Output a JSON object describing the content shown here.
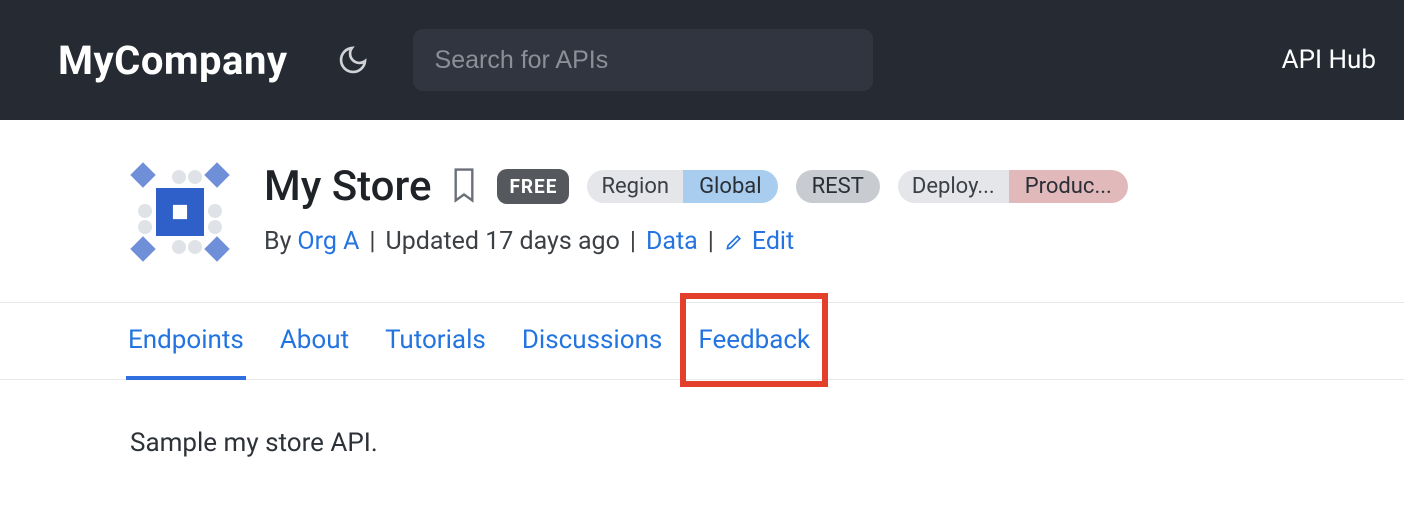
{
  "header": {
    "brand": "MyCompany",
    "search_placeholder": "Search for APIs",
    "hub_link": "API Hub"
  },
  "api": {
    "title": "My Store",
    "badges": {
      "free": "FREE",
      "region_label": "Region",
      "region_value": "Global",
      "rest": "REST",
      "deploy_label": "Deploy...",
      "deploy_value": "Produc..."
    },
    "meta": {
      "by_prefix": "By",
      "org": "Org A",
      "updated": "Updated 17 days ago",
      "category": "Data",
      "edit": "Edit"
    },
    "description": "Sample my store API."
  },
  "tabs": [
    {
      "id": "endpoints",
      "label": "Endpoints",
      "active": true
    },
    {
      "id": "about",
      "label": "About"
    },
    {
      "id": "tutorials",
      "label": "Tutorials"
    },
    {
      "id": "discussions",
      "label": "Discussions"
    },
    {
      "id": "feedback",
      "label": "Feedback",
      "highlighted": true
    }
  ]
}
